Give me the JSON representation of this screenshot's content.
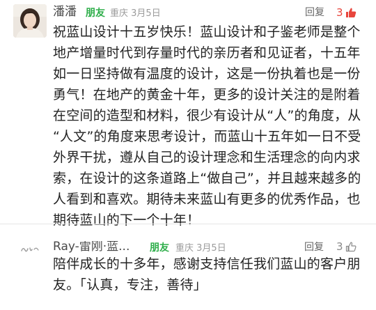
{
  "colors": {
    "friend_tag": "#2eae4a",
    "like_active": "#e8453c",
    "like_inactive": "#8a8a8a",
    "meta": "#9b9b9b"
  },
  "comments": [
    {
      "user_name": "潘潘",
      "tag": "朋友",
      "location": "重庆",
      "date": "3月5日",
      "reply_label": "回复",
      "likes": "3",
      "liked": true,
      "avatar_icon": "user-photo-avatar",
      "like_icon": "thumbs-up-icon",
      "body_lines": [
        "祝蓝山设计十五岁快乐！蓝山设计和子鉴老师是整个",
        "地产增量时代到存量时代的亲历者和见证者，十五年",
        "如一日坚持做有温度的设计，这是一份执着也是一份",
        "勇气！在地产的黄金十年，更多的设计关注的是附着",
        "在空间的造型和材料，很少有设计从“人”的角度，从",
        "“人文”的角度来思考设计，而蓝山十五年如一日不受",
        "外界干扰，遵从自己的设计理念和生活理念的向内求",
        "索，在设计的这条道路上“做自己”，并且越来越多的",
        "人看到和喜欢。期待未来蓝山有更多的优秀作品，也",
        "期待蓝山的下一个十年！"
      ]
    },
    {
      "user_name": "Ray-雷刚·蓝...",
      "tag": "朋友",
      "location": "重庆",
      "date": "3月5日",
      "reply_label": "回复",
      "likes": "3",
      "liked": false,
      "avatar_icon": "signature-logo-avatar",
      "like_icon": "thumbs-up-outline-icon",
      "body_lines": [
        "陪伴成长的十多年，感谢支持信任我们蓝山的客户朋",
        "友。「认真，专注，善待」"
      ]
    }
  ]
}
